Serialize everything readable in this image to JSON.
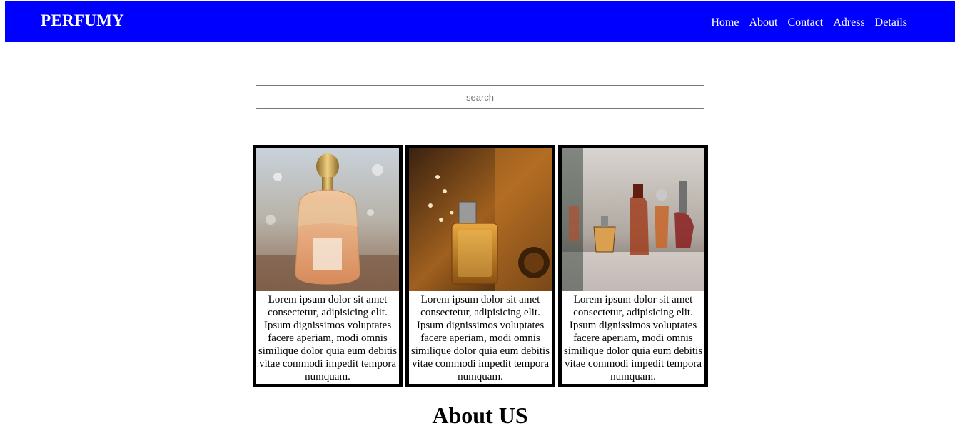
{
  "header": {
    "brand": "PERFUMY",
    "nav": [
      {
        "label": "Home"
      },
      {
        "label": "About"
      },
      {
        "label": "Contact"
      },
      {
        "label": "Adress"
      },
      {
        "label": "Details"
      }
    ]
  },
  "colors": {
    "navbar": "#0000ff",
    "card_border": "#000000"
  },
  "search": {
    "placeholder": "search",
    "value": ""
  },
  "cards": [
    {
      "image": "perfume-bottle-gold-cap-photo",
      "text": "Lorem ipsum dolor sit amet consectetur, adipisicing elit. Ipsum dignissimos voluptates facere aperiam, modi omnis similique dolor quia eum debitis vitae commodi impedit tempora numquam."
    },
    {
      "image": "perfume-bottle-amber-photo",
      "text": "Lorem ipsum dolor sit amet consectetur, adipisicing elit. Ipsum dignissimos voluptates facere aperiam, modi omnis similique dolor quia eum debitis vitae commodi impedit tempora numquam."
    },
    {
      "image": "perfume-bottles-collection-photo",
      "text": "Lorem ipsum dolor sit amet consectetur, adipisicing elit. Ipsum dignissimos voluptates facere aperiam, modi omnis similique dolor quia eum debitis vitae commodi impedit tempora numquam."
    }
  ],
  "about": {
    "title": "About US"
  }
}
